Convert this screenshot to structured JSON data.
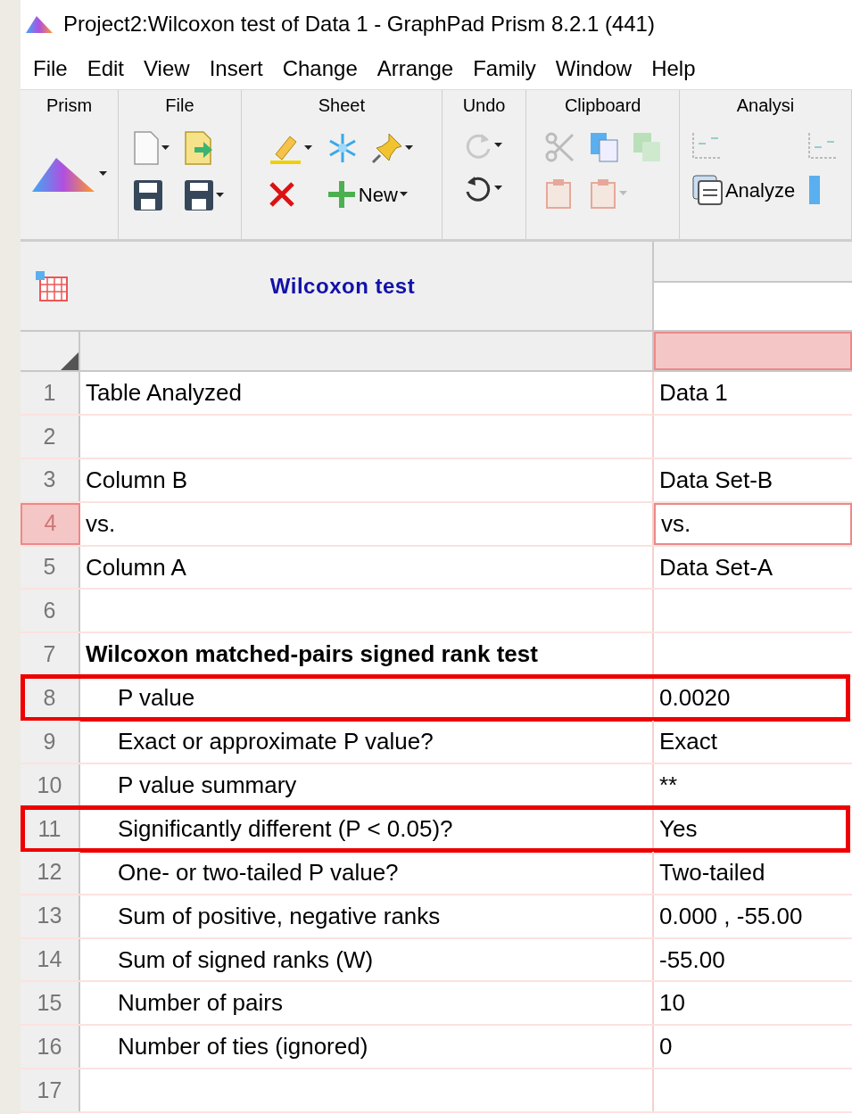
{
  "window": {
    "title": "Project2:Wilcoxon test of Data 1 - GraphPad Prism 8.2.1 (441)"
  },
  "menu": [
    "File",
    "Edit",
    "View",
    "Insert",
    "Change",
    "Arrange",
    "Family",
    "Window",
    "Help"
  ],
  "ribbon": {
    "groups": [
      {
        "label": "Prism"
      },
      {
        "label": "File"
      },
      {
        "label": "Sheet"
      },
      {
        "label": "Undo"
      },
      {
        "label": "Clipboard"
      },
      {
        "label": "Analysi"
      }
    ],
    "new_button": "New",
    "analyze_button": "Analyze"
  },
  "sheet": {
    "title": "Wilcoxon test",
    "rows": [
      {
        "number": "1",
        "label": "Table Analyzed",
        "value": "Data 1",
        "kind": "plain",
        "selected": false,
        "highlighted": false
      },
      {
        "number": "2",
        "kind": "plain",
        "selected": false,
        "highlighted": false
      },
      {
        "number": "3",
        "label": "Column B",
        "value": "Data Set-B",
        "kind": "plain",
        "selected": false,
        "highlighted": false
      },
      {
        "number": "4",
        "label": "vs.",
        "value": "vs.",
        "kind": "plain",
        "selected": true,
        "highlighted": false
      },
      {
        "number": "5",
        "label": "Column A",
        "value": "Data Set-A",
        "kind": "plain",
        "selected": false,
        "highlighted": false
      },
      {
        "number": "6",
        "kind": "plain",
        "selected": false,
        "highlighted": false
      },
      {
        "number": "7",
        "label": "Wilcoxon matched-pairs signed rank test",
        "kind": "heading",
        "selected": false,
        "highlighted": false
      },
      {
        "number": "8",
        "label": "P value",
        "value": "0.0020",
        "kind": "item",
        "selected": false,
        "highlighted": true
      },
      {
        "number": "9",
        "label": "Exact or approximate P value?",
        "value": "Exact",
        "kind": "item",
        "selected": false,
        "highlighted": false
      },
      {
        "number": "10",
        "label": "P value summary",
        "value": "**",
        "kind": "item",
        "selected": false,
        "highlighted": false
      },
      {
        "number": "11",
        "label": "Significantly different (P < 0.05)?",
        "value": "Yes",
        "kind": "item",
        "selected": false,
        "highlighted": true
      },
      {
        "number": "12",
        "label": "One- or two-tailed P value?",
        "value": "Two-tailed",
        "kind": "item",
        "selected": false,
        "highlighted": false
      },
      {
        "number": "13",
        "label": "Sum of positive, negative ranks",
        "value": "0.000 , -55.00",
        "kind": "item",
        "selected": false,
        "highlighted": false
      },
      {
        "number": "14",
        "label": "Sum of signed ranks (W)",
        "value": "-55.00",
        "kind": "item",
        "selected": false,
        "highlighted": false
      },
      {
        "number": "15",
        "label": "Number of pairs",
        "value": "10",
        "kind": "item",
        "selected": false,
        "highlighted": false
      },
      {
        "number": "16",
        "label": "Number of ties (ignored)",
        "value": "0",
        "kind": "item",
        "selected": false,
        "highlighted": false
      },
      {
        "number": "17",
        "kind": "plain",
        "selected": false,
        "highlighted": false
      }
    ]
  }
}
